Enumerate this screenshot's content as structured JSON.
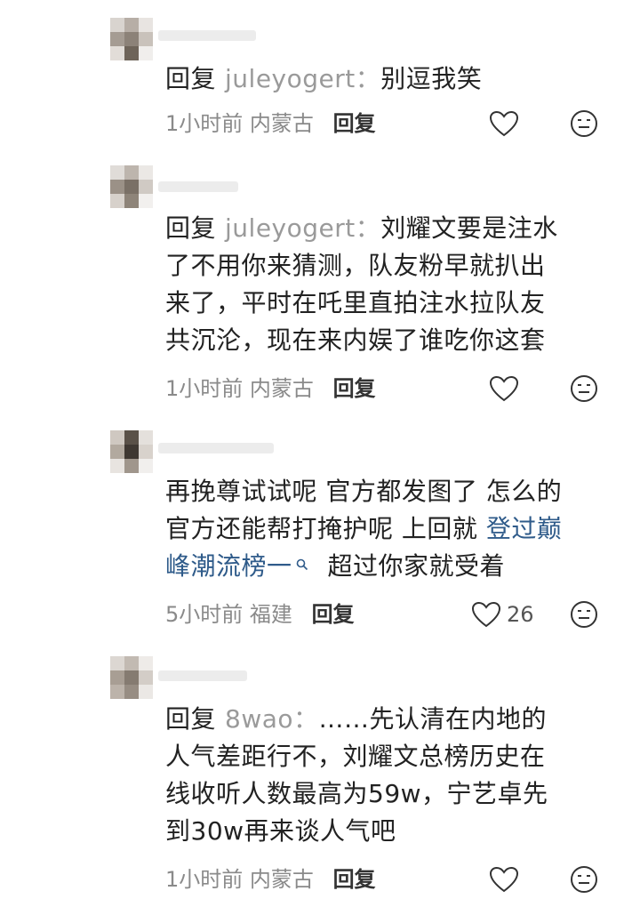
{
  "comments": [
    {
      "reply_label": "回复",
      "reply_to": "juleyogert：",
      "text": "别逗我笑",
      "time": "1小时前",
      "location": "内蒙古",
      "reply_button": "回复",
      "likes": ""
    },
    {
      "reply_label": "回复",
      "reply_to": "juleyogert：",
      "line1": "刘耀文要是注水",
      "line2": "了不用你来猜测，队友粉早就扒出",
      "line3": "来了，平时在吒里直拍注水拉队友",
      "line4": "共沉沦，现在来内娱了谁吃你这套",
      "time": "1小时前",
      "location": "内蒙古",
      "reply_button": "回复",
      "likes": ""
    },
    {
      "line1": "再挽尊试试呢 官方都发图了 怎么的",
      "line2_a": "官方还能帮打掩护呢 上回就 ",
      "link_a": "登过巅",
      "link_b": "峰潮流榜一",
      "line3_b": "超过你家就受着",
      "time": "5小时前",
      "location": "福建",
      "reply_button": "回复",
      "likes": "26"
    },
    {
      "reply_label": "回复",
      "reply_to": "8wao：",
      "line1": "……先认清在内地的",
      "line2": "人气差距行不，刘耀文总榜历史在",
      "line3": "线收听人数最高为59w，宁艺卓先",
      "line4": "到30w再来谈人气吧",
      "time": "1小时前",
      "location": "内蒙古",
      "reply_button": "回复",
      "likes": ""
    }
  ]
}
